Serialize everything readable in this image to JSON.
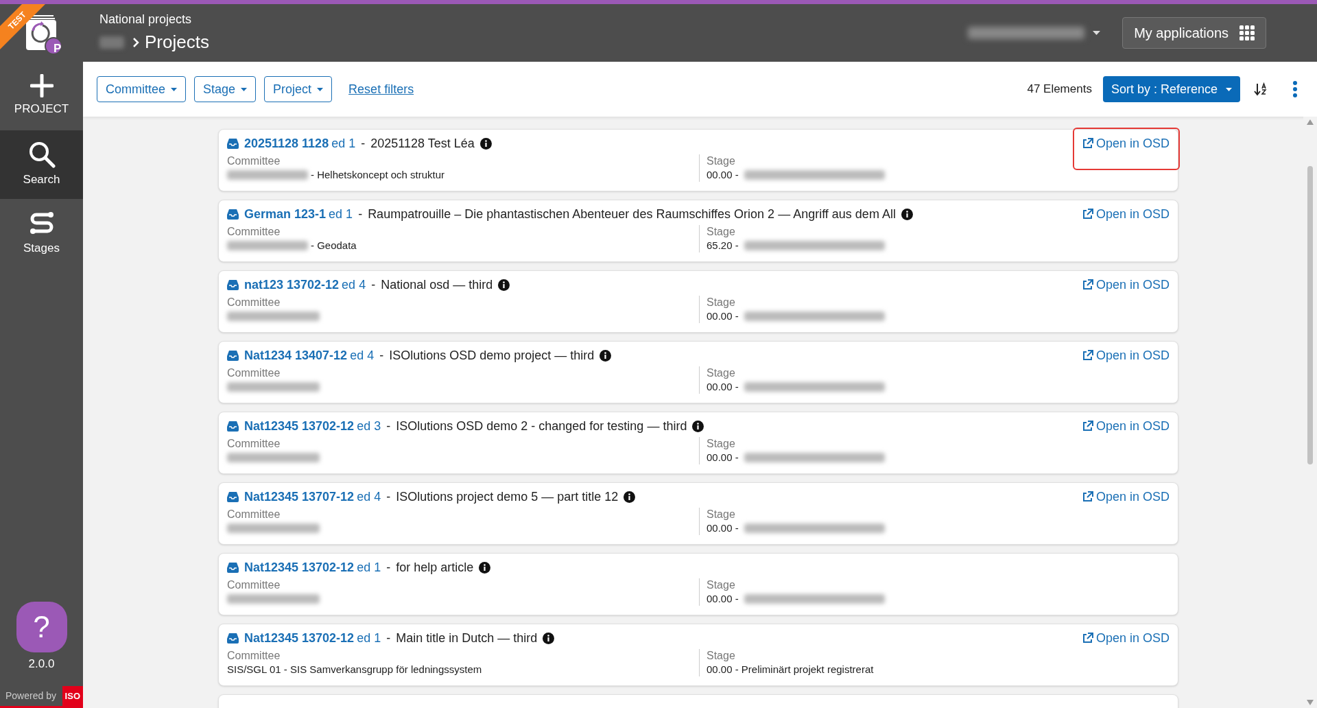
{
  "header": {
    "section": "National projects",
    "title": "Projects",
    "apps_button": "My applications"
  },
  "sidebar": {
    "badge": "TEST",
    "avatar_letter": "P",
    "items": [
      {
        "label": "PROJECT",
        "kind": "add",
        "selected": false
      },
      {
        "label": "Search",
        "kind": "search",
        "selected": true
      },
      {
        "label": "Stages",
        "kind": "stages",
        "selected": false
      }
    ],
    "help": "?",
    "version": "2.0.0",
    "powered_by": "Powered by",
    "iso": "ISO"
  },
  "filters": [
    {
      "label": "Committee"
    },
    {
      "label": "Stage"
    },
    {
      "label": "Project"
    }
  ],
  "reset_filters": "Reset filters",
  "count": "47 Elements",
  "sort_button": "Sort by : Reference",
  "projects": [
    {
      "reference": "20251128 1128",
      "edition": "ed 1",
      "separator": "-",
      "title": "20251128 Test Léa",
      "committee_label": "Committee",
      "committee_redacted": true,
      "committee": "- Helhetskoncept och struktur",
      "stage_label": "Stage",
      "stage": "00.00 -",
      "stage_redacted": true,
      "open_link": "Open in OSD",
      "highlighted": true
    },
    {
      "reference": "German 123-1",
      "edition": "ed 1",
      "separator": "-",
      "title": "Raumpatrouille – Die phantastischen Abenteuer des Raumschiffes Orion 2 — Angriff aus dem All",
      "committee_label": "Committee",
      "committee_redacted": true,
      "committee": "- Geodata",
      "stage_label": "Stage",
      "stage": "65.20 -",
      "stage_redacted": true,
      "open_link": "Open in OSD",
      "highlighted": false
    },
    {
      "reference": "nat123 13702-12",
      "edition": "ed 4",
      "separator": "-",
      "title": "National osd — third",
      "committee_label": "Committee",
      "committee_redacted": true,
      "stage_label": "Stage",
      "stage": "00.00 -",
      "stage_redacted": true,
      "open_link": "Open in OSD",
      "highlighted": false
    },
    {
      "reference": "Nat1234 13407-12",
      "edition": "ed 4",
      "separator": "-",
      "title": "ISOlutions OSD demo project — third",
      "committee_label": "Committee",
      "committee_redacted": true,
      "stage_label": "Stage",
      "stage": "00.00 -",
      "stage_redacted": true,
      "open_link": "Open in OSD",
      "highlighted": false
    },
    {
      "reference": "Nat12345 13702-12",
      "edition": "ed 3",
      "separator": "-",
      "title": "ISOlutions OSD demo 2 - changed for testing — third",
      "committee_label": "Committee",
      "committee_redacted": true,
      "stage_label": "Stage",
      "stage": "00.00 -",
      "stage_redacted": true,
      "open_link": "Open in OSD",
      "highlighted": false
    },
    {
      "reference": "Nat12345 13707-12",
      "edition": "ed 4",
      "separator": "-",
      "title": "ISOlutions project demo 5 — part title 12",
      "committee_label": "Committee",
      "committee_redacted": true,
      "stage_label": "Stage",
      "stage": "00.00 -",
      "stage_redacted": true,
      "open_link": "Open in OSD",
      "highlighted": false
    },
    {
      "reference": "Nat12345 13702-12",
      "edition": "ed 1",
      "separator": "-",
      "title": "for help article",
      "committee_label": "Committee",
      "committee_redacted": true,
      "stage_label": "Stage",
      "stage": "00.00 -",
      "stage_redacted": true,
      "highlighted": false
    },
    {
      "reference": "Nat12345 13702-12",
      "edition": "ed 1",
      "separator": "-",
      "title": "Main title in Dutch — third",
      "committee_label": "Committee",
      "committee_redacted": false,
      "committee": "SIS/SGL 01 - SIS Samverkansgrupp för ledningssystem",
      "stage_label": "Stage",
      "stage": "00.00 - Preliminärt projekt registrerat",
      "stage_redacted": false,
      "open_link": "Open in OSD",
      "highlighted": false
    }
  ]
}
